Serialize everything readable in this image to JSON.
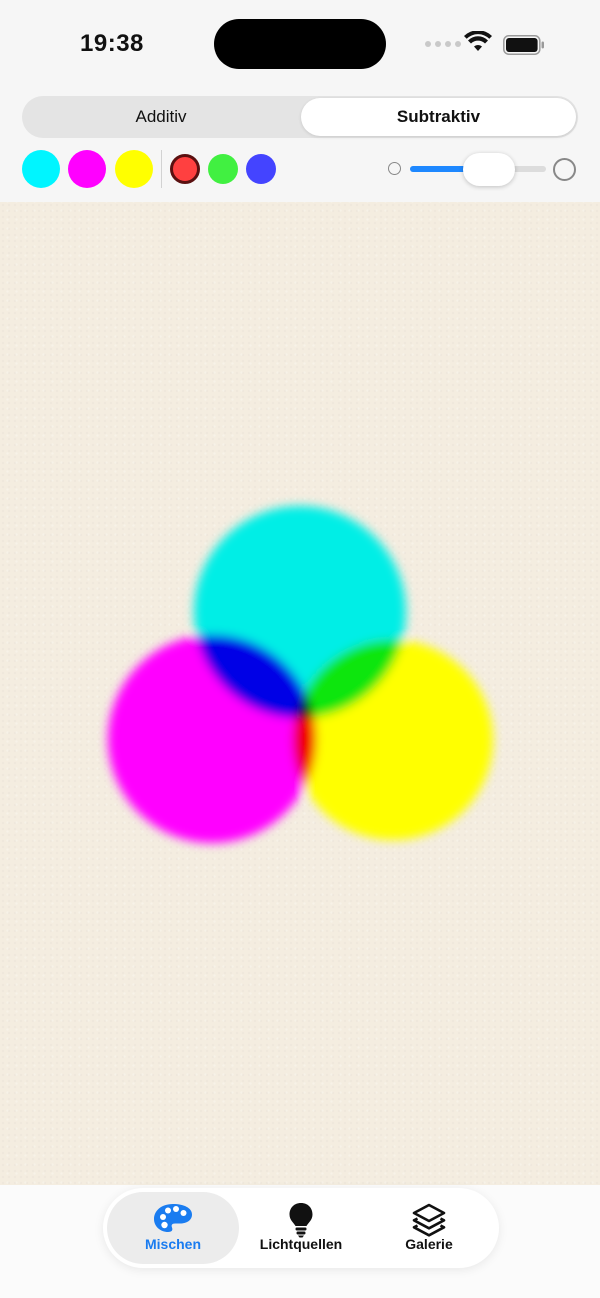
{
  "status_bar": {
    "time": "19:38"
  },
  "mode_toggle": {
    "options": [
      "Additiv",
      "Subtraktiv"
    ],
    "selected": "Subtraktiv"
  },
  "palette": {
    "subtractive_colors": [
      "#00f5ff",
      "#ff00ff",
      "#ffff00"
    ],
    "additive_colors": [
      "#ff4040",
      "#41f041",
      "#4444ff"
    ],
    "selected_color": "#ff4040"
  },
  "size_slider": {
    "value": 0.58
  },
  "canvas": {
    "background": "#f4ede0",
    "circles": [
      {
        "name": "cyan",
        "color": "#00eee6"
      },
      {
        "name": "magenta",
        "color": "#ff00ff"
      },
      {
        "name": "yellow",
        "color": "#ffff00"
      }
    ]
  },
  "tab_bar": {
    "tabs": [
      {
        "label": "Mischen",
        "icon": "palette-icon"
      },
      {
        "label": "Lichtquellen",
        "icon": "lightbulb-icon"
      },
      {
        "label": "Galerie",
        "icon": "layers-icon"
      }
    ],
    "active": "Mischen",
    "accent": "#1a7cf0"
  }
}
